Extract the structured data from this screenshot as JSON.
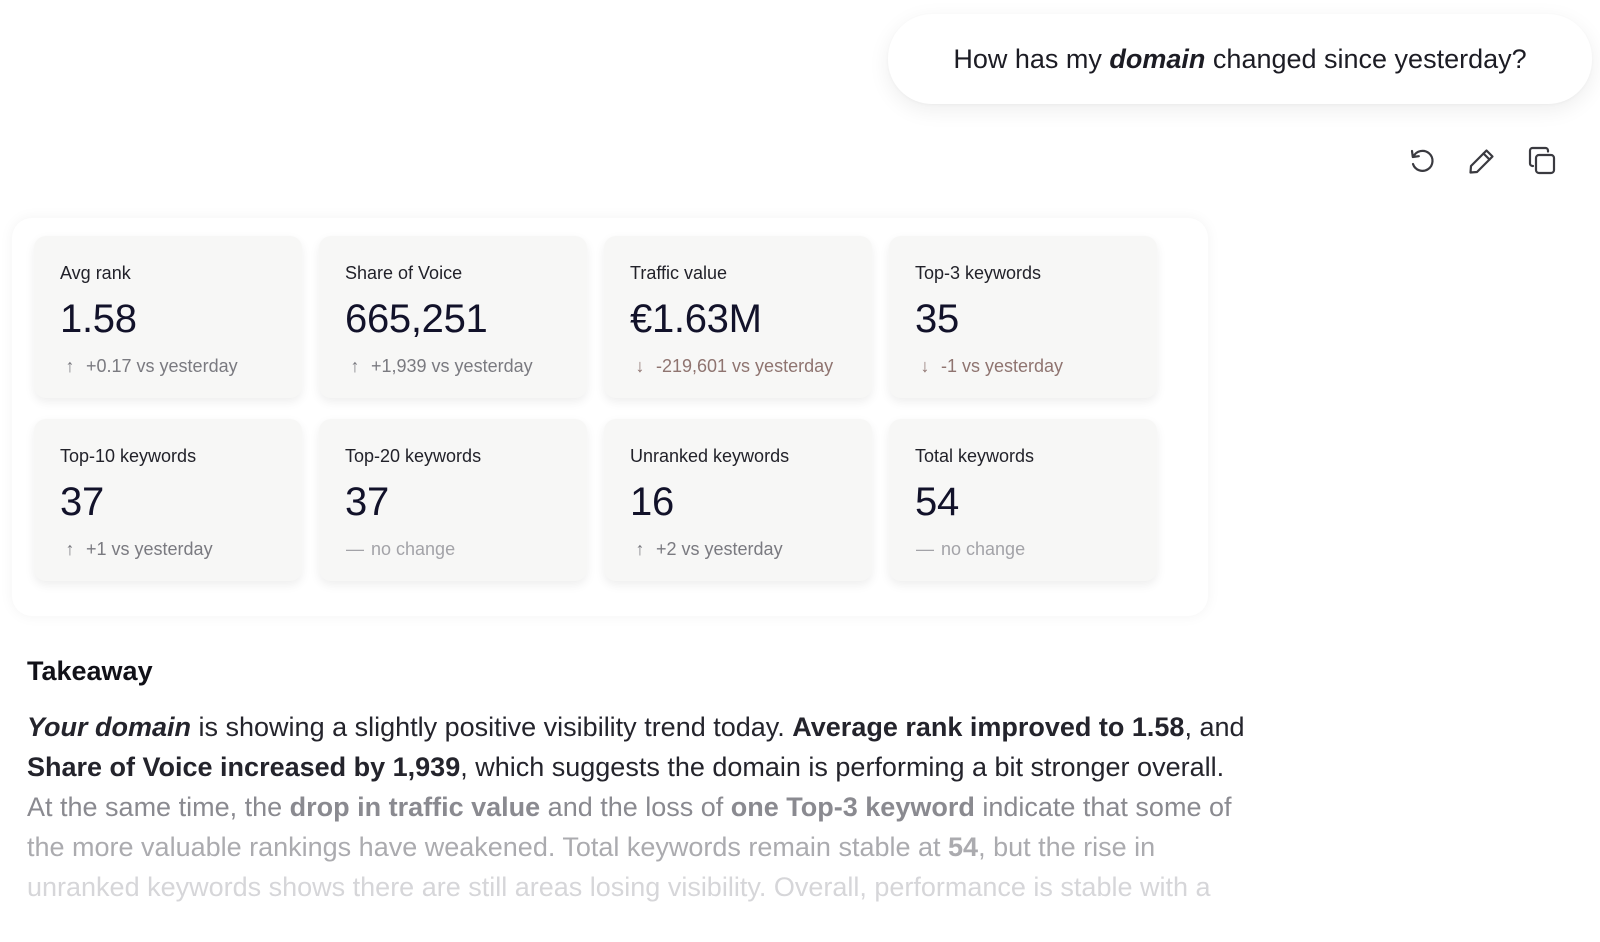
{
  "user_message": {
    "before": "How has my ",
    "emphasis": "domain",
    "after": " changed since yesterday?"
  },
  "actions": [
    {
      "icon": "refresh-icon"
    },
    {
      "icon": "pencil-icon"
    },
    {
      "icon": "copy-icon"
    }
  ],
  "metrics": [
    {
      "label": "Avg rank",
      "value": "1.58",
      "delta": "+0.17 vs yesterday",
      "direction": "up"
    },
    {
      "label": "Share of Voice",
      "value": "665,251",
      "delta": "+1,939 vs yesterday",
      "direction": "up"
    },
    {
      "label": "Traffic value",
      "value": "€1.63M",
      "delta": "-219,601 vs yesterday",
      "direction": "down"
    },
    {
      "label": "Top-3 keywords",
      "value": "35",
      "delta": "-1 vs yesterday",
      "direction": "down"
    },
    {
      "label": "Top-10 keywords",
      "value": "37",
      "delta": "+1 vs yesterday",
      "direction": "up"
    },
    {
      "label": "Top-20 keywords",
      "value": "37",
      "delta": "no change",
      "direction": "flat"
    },
    {
      "label": "Unranked keywords",
      "value": "16",
      "delta": "+2 vs yesterday",
      "direction": "up"
    },
    {
      "label": "Total keywords",
      "value": "54",
      "delta": "no change",
      "direction": "flat"
    }
  ],
  "takeaway": {
    "title": "Takeaway",
    "line1": {
      "em": "Your domain",
      "t1": " is showing a slightly positive visibility trend today. ",
      "b1": "Average rank improved to 1.58",
      "t2": ", and"
    },
    "line2": {
      "b1": "Share of Voice increased by 1,939",
      "t1": ", which suggests the domain is performing a bit stronger overall."
    },
    "line3": {
      "t1": "At the same time, the ",
      "b1": "drop in traffic value",
      "t2": " and the loss of ",
      "b2": "one Top-3 keyword",
      "t3": " indicate that some of"
    },
    "line4": {
      "t1": "the more valuable rankings have weakened. Total keywords remain stable at ",
      "b1": "54",
      "t2": ", but the rise in"
    },
    "line5": {
      "t1": "unranked keywords shows there are still areas losing visibility. Overall, performance is stable with a"
    }
  },
  "colors": {
    "card_bg": "#f7f7f6",
    "text_primary": "#12122a",
    "delta_up": "#7a7a80",
    "delta_down": "#8f7470",
    "delta_flat": "#a3a3a8"
  }
}
